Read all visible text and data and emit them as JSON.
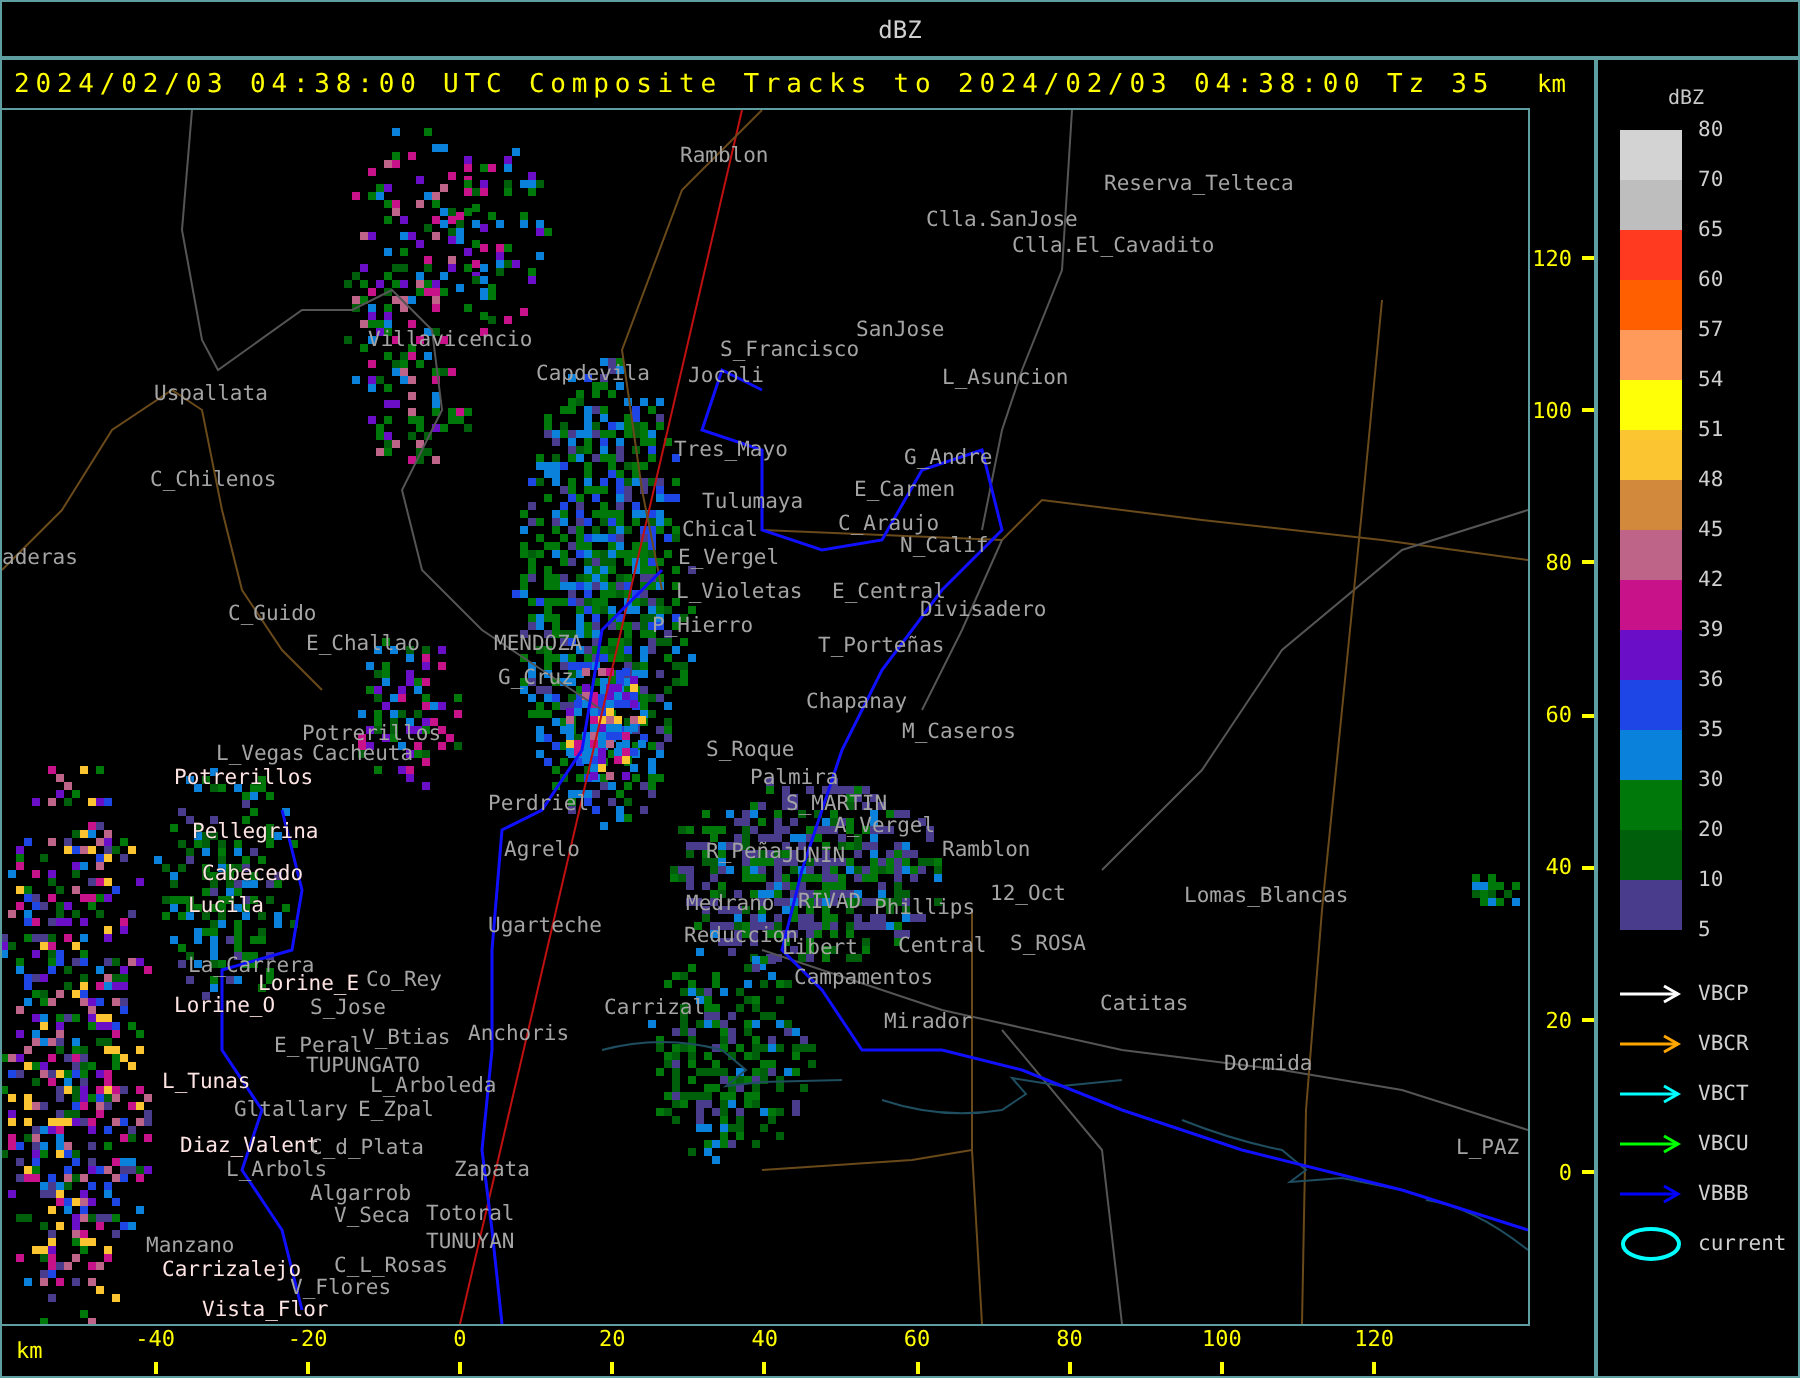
{
  "window": {
    "title": "dBZ"
  },
  "header": {
    "caption": "2024/02/03 04:38:00 UTC Composite Tracks to 2024/02/03 04:38:00 Tz 35",
    "axis_unit": "km"
  },
  "map": {
    "places": [
      {
        "name": "Ramblon",
        "highlighted": false
      },
      {
        "name": "Reserva_Telteca",
        "highlighted": false
      },
      {
        "name": "Clla.SanJose",
        "highlighted": false
      },
      {
        "name": "Clla.El_Cavadito",
        "highlighted": false
      },
      {
        "name": "Villavicencio",
        "highlighted": false
      },
      {
        "name": "SanJose",
        "highlighted": false
      },
      {
        "name": "S_Francisco",
        "highlighted": false
      },
      {
        "name": "Capdevila",
        "highlighted": false
      },
      {
        "name": "Jocoli",
        "highlighted": false
      },
      {
        "name": "L_Asuncion",
        "highlighted": false
      },
      {
        "name": "Uspallata",
        "highlighted": false
      },
      {
        "name": "Tres_Mayo",
        "highlighted": false
      },
      {
        "name": "G_Andre",
        "highlighted": false
      },
      {
        "name": "C_Chilenos",
        "highlighted": false
      },
      {
        "name": "E_Carmen",
        "highlighted": false
      },
      {
        "name": "Tulumaya",
        "highlighted": false
      },
      {
        "name": "Chical",
        "highlighted": false
      },
      {
        "name": "C_Araujo",
        "highlighted": false
      },
      {
        "name": "aderas",
        "highlighted": false
      },
      {
        "name": "E_Vergel",
        "highlighted": false
      },
      {
        "name": "N_Calif",
        "highlighted": false
      },
      {
        "name": "L_Violetas",
        "highlighted": false
      },
      {
        "name": "E_Central",
        "highlighted": false
      },
      {
        "name": "C_Guido",
        "highlighted": false
      },
      {
        "name": "Divisadero",
        "highlighted": false
      },
      {
        "name": "P_Hierro",
        "highlighted": false
      },
      {
        "name": "E_Challao",
        "highlighted": false
      },
      {
        "name": "MENDOZA",
        "highlighted": false
      },
      {
        "name": "T_Porteñas",
        "highlighted": false
      },
      {
        "name": "G_Cruz",
        "highlighted": false
      },
      {
        "name": "Chapanay",
        "highlighted": false
      },
      {
        "name": "Potrerillos",
        "highlighted": false
      },
      {
        "name": "M_Caseros",
        "highlighted": false
      },
      {
        "name": "L_Vegas",
        "highlighted": false
      },
      {
        "name": "Cacheuta",
        "highlighted": false
      },
      {
        "name": "S_Roque",
        "highlighted": false
      },
      {
        "name": "Potrerillos",
        "highlighted": true
      },
      {
        "name": "Palmira",
        "highlighted": false
      },
      {
        "name": "Perdriel",
        "highlighted": false
      },
      {
        "name": "S_MARTIN",
        "highlighted": false
      },
      {
        "name": "Pellegrina",
        "highlighted": true
      },
      {
        "name": "A_Vergel",
        "highlighted": false
      },
      {
        "name": "Agrelo",
        "highlighted": false
      },
      {
        "name": "R_Peña",
        "highlighted": false
      },
      {
        "name": "JUNIN",
        "highlighted": false
      },
      {
        "name": "Ramblon",
        "highlighted": false
      },
      {
        "name": "Cabecedo",
        "highlighted": true
      },
      {
        "name": "Lucila",
        "highlighted": true
      },
      {
        "name": "Medrano",
        "highlighted": false
      },
      {
        "name": "RIVAD",
        "highlighted": false
      },
      {
        "name": "Phillips",
        "highlighted": false
      },
      {
        "name": "12_Oct",
        "highlighted": false
      },
      {
        "name": "Lomas_Blancas",
        "highlighted": false
      },
      {
        "name": "Ugarteche",
        "highlighted": false
      },
      {
        "name": "Reduccion",
        "highlighted": false
      },
      {
        "name": "Libert",
        "highlighted": false
      },
      {
        "name": "Central",
        "highlighted": false
      },
      {
        "name": "S_ROSA",
        "highlighted": false
      },
      {
        "name": "La_Carrera",
        "highlighted": false
      },
      {
        "name": "Lorine_E",
        "highlighted": true
      },
      {
        "name": "Co_Rey",
        "highlighted": false
      },
      {
        "name": "Campamentos",
        "highlighted": false
      },
      {
        "name": "Lorine_O",
        "highlighted": true
      },
      {
        "name": "S_Jose",
        "highlighted": false
      },
      {
        "name": "Carrizal",
        "highlighted": false
      },
      {
        "name": "Catitas",
        "highlighted": false
      },
      {
        "name": "E_Peral",
        "highlighted": false
      },
      {
        "name": "V_Btias",
        "highlighted": false
      },
      {
        "name": "Anchoris",
        "highlighted": false
      },
      {
        "name": "Mirador",
        "highlighted": false
      },
      {
        "name": "TUPUNGATO",
        "highlighted": false
      },
      {
        "name": "Dormida",
        "highlighted": false
      },
      {
        "name": "L_Tunas",
        "highlighted": true
      },
      {
        "name": "L_Arboleda",
        "highlighted": false
      },
      {
        "name": "Gltallary",
        "highlighted": false
      },
      {
        "name": "E_Zpal",
        "highlighted": false
      },
      {
        "name": "Diaz_Valent",
        "highlighted": true
      },
      {
        "name": "C_d_Plata",
        "highlighted": false
      },
      {
        "name": "L_PAZ",
        "highlighted": false
      },
      {
        "name": "L_Arbols",
        "highlighted": false
      },
      {
        "name": "Zapata",
        "highlighted": false
      },
      {
        "name": "Algarrob",
        "highlighted": false
      },
      {
        "name": "V_Seca",
        "highlighted": false
      },
      {
        "name": "Totoral",
        "highlighted": false
      },
      {
        "name": "Manzano",
        "highlighted": false
      },
      {
        "name": "TUNUYAN",
        "highlighted": false
      },
      {
        "name": "Carrizalejo",
        "highlighted": true
      },
      {
        "name": "C_L_Rosas",
        "highlighted": false
      },
      {
        "name": "V_Flores",
        "highlighted": false
      },
      {
        "name": "Vista_Flor",
        "highlighted": true
      }
    ]
  },
  "y_axis": {
    "ticks": [
      "120",
      "100",
      "80",
      "60",
      "40",
      "20",
      "0"
    ]
  },
  "x_axis": {
    "unit": "km",
    "ticks": [
      "-40",
      "-20",
      "0",
      "20",
      "40",
      "60",
      "80",
      "100",
      "120"
    ]
  },
  "legend": {
    "title": "dBZ",
    "bins": [
      {
        "label": "80",
        "color": "#d3d3d3"
      },
      {
        "label": "70",
        "color": "#bebebe"
      },
      {
        "label": "65",
        "color": "#ff3a20"
      },
      {
        "label": "60",
        "color": "#ff5f00"
      },
      {
        "label": "57",
        "color": "#ff9a5a"
      },
      {
        "label": "54",
        "color": "#ffff08"
      },
      {
        "label": "51",
        "color": "#fbc532"
      },
      {
        "label": "48",
        "color": "#d2893c"
      },
      {
        "label": "45",
        "color": "#be6488"
      },
      {
        "label": "42",
        "color": "#c8128a"
      },
      {
        "label": "39",
        "color": "#6a0ec8"
      },
      {
        "label": "36",
        "color": "#1e46e6"
      },
      {
        "label": "35",
        "color": "#0a82dc"
      },
      {
        "label": "30",
        "color": "#00780a"
      },
      {
        "label": "20",
        "color": "#005f0a"
      },
      {
        "label": "10",
        "color": "#4a3c8c"
      }
    ],
    "bottom_label": "5",
    "tracks": [
      {
        "kind": "arrow",
        "label": "VBCP",
        "color": "#ffffff"
      },
      {
        "kind": "arrow",
        "label": "VBCR",
        "color": "#ffa500"
      },
      {
        "kind": "arrow",
        "label": "VBCT",
        "color": "#00ffff"
      },
      {
        "kind": "arrow",
        "label": "VBCU",
        "color": "#00ff00"
      },
      {
        "kind": "arrow",
        "label": "VBBB",
        "color": "#0000ff"
      },
      {
        "kind": "ellipse",
        "label": "current",
        "color": "#00ffff"
      }
    ]
  }
}
